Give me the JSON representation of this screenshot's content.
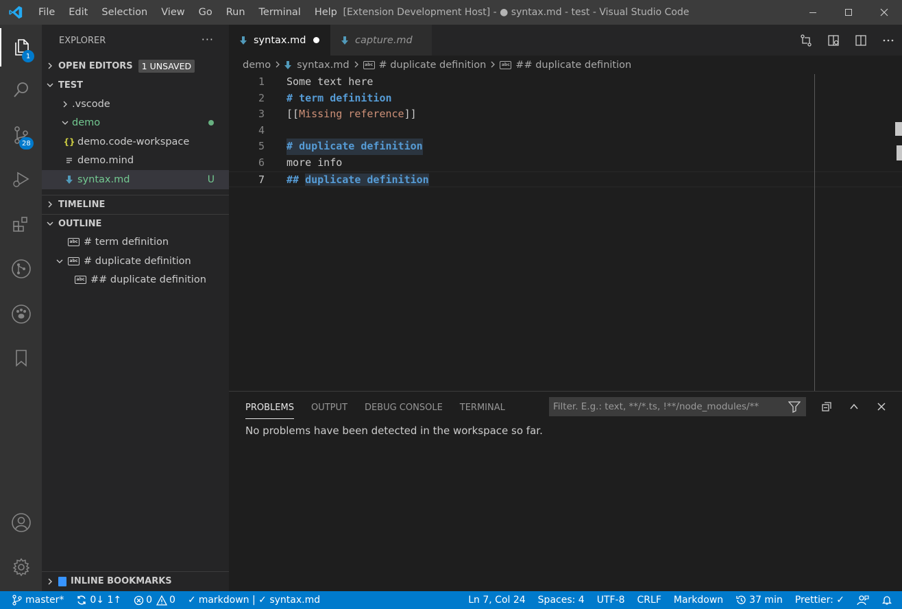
{
  "titlebar": {
    "menu": [
      "File",
      "Edit",
      "Selection",
      "View",
      "Go",
      "Run",
      "Terminal",
      "Help"
    ],
    "title": "[Extension Development Host] - ● syntax.md - test - Visual Studio Code"
  },
  "activity": {
    "explorer_badge": "1",
    "scm_badge": "28"
  },
  "sidebar": {
    "header": "EXPLORER",
    "more": "···",
    "open_editors": {
      "label": "OPEN EDITORS",
      "badge": "1 UNSAVED"
    },
    "workspace": {
      "label": "TEST",
      "items": [
        {
          "label": ".vscode",
          "git": ""
        },
        {
          "label": "demo",
          "git": "●"
        },
        {
          "label": "demo.code-workspace",
          "git": ""
        },
        {
          "label": "demo.mind",
          "git": ""
        },
        {
          "label": "syntax.md",
          "git": "U"
        }
      ]
    },
    "timeline": "TIMELINE",
    "outline": {
      "label": "OUTLINE",
      "items": [
        "# term definition",
        "# duplicate definition",
        "## duplicate definition"
      ]
    },
    "inline_bookmarks": "INLINE BOOKMARKS"
  },
  "editor": {
    "tabs": [
      {
        "label": "syntax.md"
      },
      {
        "label": "capture.md"
      }
    ],
    "breadcrumbs": [
      "demo",
      "syntax.md",
      "# duplicate definition",
      "## duplicate definition"
    ],
    "lines": [
      {
        "num": "1",
        "text": "Some text here"
      },
      {
        "num": "2",
        "mark": "#",
        "heading": "term definition"
      },
      {
        "num": "3",
        "open": "[[",
        "link": "Missing reference",
        "close": "]]"
      },
      {
        "num": "4",
        "text": ""
      },
      {
        "num": "5",
        "mark": "#",
        "heading": "duplicate definition"
      },
      {
        "num": "6",
        "text": "more info"
      },
      {
        "num": "7",
        "mark": "##",
        "heading": "duplicate definition"
      }
    ]
  },
  "panel": {
    "tabs": [
      "PROBLEMS",
      "OUTPUT",
      "DEBUG CONSOLE",
      "TERMINAL"
    ],
    "filter_placeholder": "Filter. E.g.: text, **/*.ts, !**/node_modules/**",
    "message": "No problems have been detected in the workspace so far."
  },
  "statusbar": {
    "branch": "master*",
    "sync": "0↓ 1↑",
    "errors": "0",
    "warnings": "0",
    "lint": "markdown | ✓ syntax.md",
    "position": "Ln 7, Col 24",
    "spaces": "Spaces: 4",
    "encoding": "UTF-8",
    "eol": "CRLF",
    "language": "Markdown",
    "timer": "37 min",
    "prettier": "Prettier: ✓"
  },
  "colors": {
    "accent": "#007acc",
    "heading": "#569cd6",
    "link": "#ce9178",
    "git_added": "#73c991"
  }
}
